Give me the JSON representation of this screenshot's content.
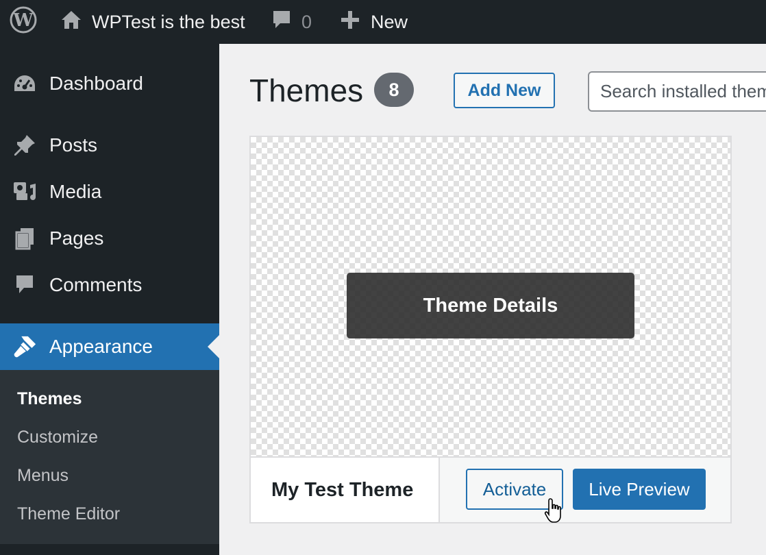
{
  "adminbar": {
    "site_name": "WPTest is the best",
    "comments_count": "0",
    "new_label": "New"
  },
  "sidebar": {
    "items": [
      {
        "label": "Dashboard",
        "icon": "dashboard-icon"
      },
      {
        "label": "Posts",
        "icon": "pin-icon"
      },
      {
        "label": "Media",
        "icon": "media-icon"
      },
      {
        "label": "Pages",
        "icon": "pages-icon"
      },
      {
        "label": "Comments",
        "icon": "comment-icon"
      },
      {
        "label": "Appearance",
        "icon": "paintbrush-icon",
        "active": true
      }
    ],
    "submenu": [
      {
        "label": "Themes",
        "current": true
      },
      {
        "label": "Customize"
      },
      {
        "label": "Menus"
      },
      {
        "label": "Theme Editor"
      }
    ]
  },
  "main": {
    "title": "Themes",
    "theme_count": "8",
    "add_new_label": "Add New",
    "search_placeholder": "Search installed themes...",
    "theme_card": {
      "details_label": "Theme Details",
      "name": "My Test Theme",
      "activate_label": "Activate",
      "live_preview_label": "Live Preview"
    }
  },
  "colors": {
    "admin_dark": "#1d2327",
    "accent_blue": "#2271b1",
    "submenu_bg": "#2c3338",
    "content_bg": "#f0f0f1"
  }
}
